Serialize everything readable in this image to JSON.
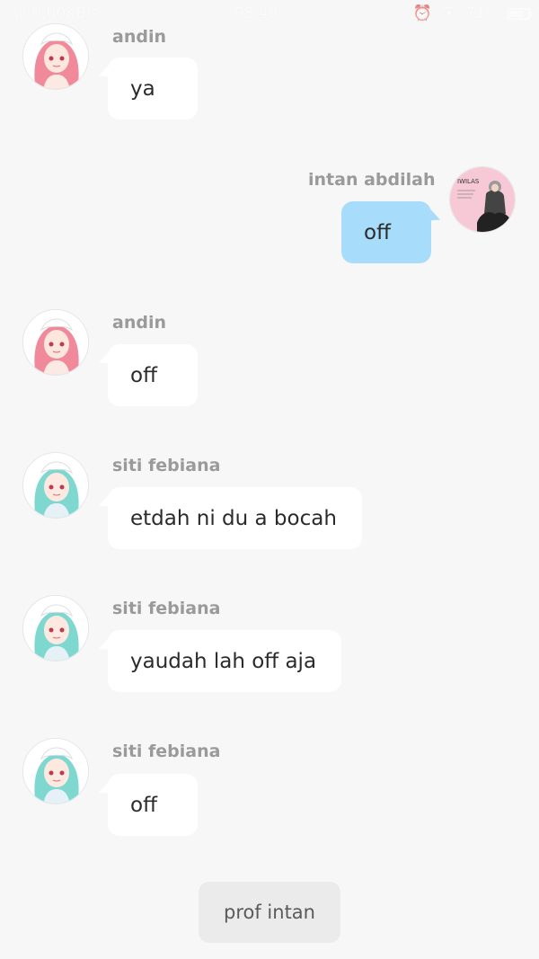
{
  "status_bar": {
    "network": "all 0,00KB/s",
    "time": "08.40",
    "battery": "71%"
  },
  "messages": [
    {
      "sender": "andin",
      "text": "ya",
      "side": "left",
      "avatar": "pink-hair-avatar"
    },
    {
      "sender": "intan abdilah",
      "text": "off",
      "side": "right",
      "avatar": "hijab-girl-avatar"
    },
    {
      "sender": "andin",
      "text": "off",
      "side": "left",
      "avatar": "pink-hair-avatar"
    },
    {
      "sender": "siti febiana",
      "text": "etdah ni du a bocah",
      "side": "left",
      "avatar": "teal-hair-avatar"
    },
    {
      "sender": "siti febiana",
      "text": "yaudah lah off aja",
      "side": "left",
      "avatar": "teal-hair-avatar"
    },
    {
      "sender": "siti febiana",
      "text": "off",
      "side": "left",
      "avatar": "teal-hair-avatar"
    }
  ],
  "bottom_button": {
    "label": "prof intan"
  },
  "avatar_caption": "IWILAS",
  "colors": {
    "background": "#f7f7f7",
    "bubble_left": "#ffffff",
    "bubble_right": "#a8dcfb",
    "sender": "#9a9a9a"
  }
}
